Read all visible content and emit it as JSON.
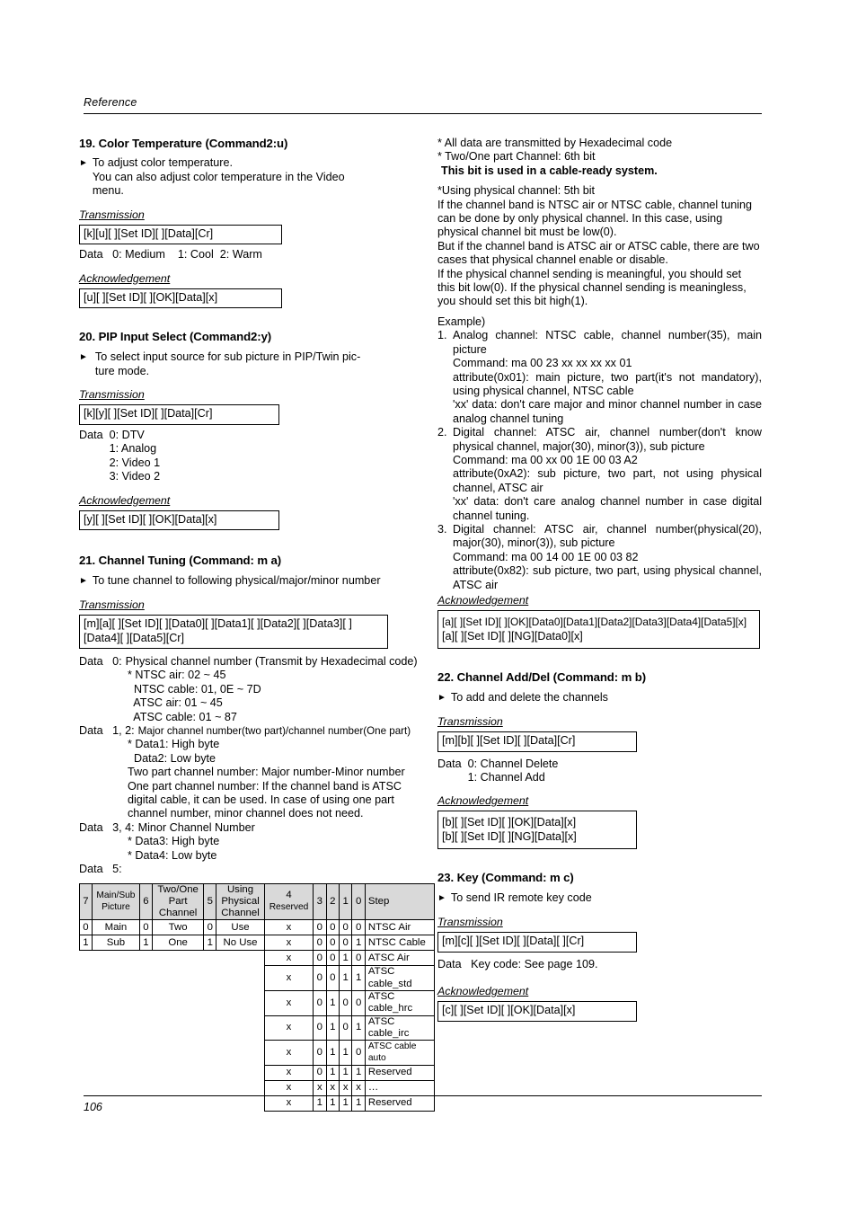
{
  "header": {
    "label": "Reference"
  },
  "footer": {
    "page": "106"
  },
  "left": {
    "s19": {
      "title": "19. Color Temperature (Command2:u)",
      "bullet": "To adjust color temperature.\nYou can also adjust color temperature in the Video\nmenu.",
      "transmission_label": "Transmission",
      "transmission_code": "[k][u][  ][Set ID][  ][Data][Cr]",
      "data_line": "Data   0: Medium    1: Cool  2: Warm",
      "ack_label": "Acknowledgement",
      "ack_code": "[u][  ][Set ID][  ][OK][Data][x]"
    },
    "s20": {
      "title": "20. PIP Input Select (Command2:y)",
      "bullet": "To select input source for sub picture in PIP/Twin pic-\nture mode.",
      "transmission_label": "Transmission",
      "transmission_code": "[k][y][  ][Set ID][  ][Data][Cr]",
      "data_key": "Data  ",
      "data_values": [
        "0: DTV",
        "1: Analog",
        "2: Video 1",
        "3: Video 2"
      ],
      "ack_label": "Acknowledgement",
      "ack_code": "[y][  ][Set ID][  ][OK][Data][x]"
    },
    "s21": {
      "title": "21. Channel Tuning (Command: m a)",
      "bullet": "To tune channel to following physical/major/minor number",
      "transmission_label": "Transmission",
      "transmission_code": "[m][a][  ][Set ID][  ][Data0][  ][Data1][  ][Data2][  ][Data3][  ]\n[Data4][  ][Data5][Cr]",
      "data0_key": "Data   0:",
      "data0_val": "Physical channel number (Transmit by Hexadecimal code)",
      "data0_sub": [
        "* NTSC air: 02 ~ 45",
        "  NTSC cable: 01, 0E ~ 7D",
        "  ATSC air: 01 ~ 45",
        "  ATSC cable: 01 ~ 87"
      ],
      "data12_key": "Data   1, 2:",
      "data12_val": "Major channel number(two part)/channel number(One part)",
      "data12_sub": [
        "* Data1: High byte",
        "  Data2: Low byte",
        "Two part channel number: Major number-Minor number",
        "One part channel number: If the channel band is ATSC",
        "digital cable, it can be used. In case of using one part",
        "channel number, minor channel does not need."
      ],
      "data34_key": "Data   3, 4:",
      "data34_val": "Minor Channel Number",
      "data34_sub": [
        "* Data3: High byte",
        "* Data4: Low byte"
      ],
      "data5_key": "Data   5:"
    },
    "bit_table": {
      "headers": [
        "7",
        "Main/Sub Picture",
        "6",
        "Two/One Part Channel",
        "5",
        "Using Physical Channel",
        "4 Reserved",
        "3",
        "2",
        "1",
        "0",
        "Step"
      ],
      "header_res_num": "4",
      "header_res_word": "Reserved",
      "rows": [
        {
          "b7": "0",
          "n7": "Main",
          "b6": "0",
          "n6": "Two",
          "b5": "0",
          "n5": "Use",
          "r4": "x",
          "b3": "0",
          "b2": "0",
          "b1": "0",
          "b0": "0",
          "step": "NTSC Air"
        },
        {
          "b7": "1",
          "n7": "Sub",
          "b6": "1",
          "n6": "One",
          "b5": "1",
          "n5": "No Use",
          "r4": "x",
          "b3": "0",
          "b2": "0",
          "b1": "0",
          "b0": "1",
          "step": "NTSC Cable"
        },
        {
          "r4": "x",
          "b3": "0",
          "b2": "0",
          "b1": "1",
          "b0": "0",
          "step": "ATSC Air"
        },
        {
          "r4": "x",
          "b3": "0",
          "b2": "0",
          "b1": "1",
          "b0": "1",
          "step": "ATSC cable_std"
        },
        {
          "r4": "x",
          "b3": "0",
          "b2": "1",
          "b1": "0",
          "b0": "0",
          "step": "ATSC cable_hrc"
        },
        {
          "r4": "x",
          "b3": "0",
          "b2": "1",
          "b1": "0",
          "b0": "1",
          "step": "ATSC cable_irc"
        },
        {
          "r4": "x",
          "b3": "0",
          "b2": "1",
          "b1": "1",
          "b0": "0",
          "step": "ATSC cable auto"
        },
        {
          "r4": "x",
          "b3": "0",
          "b2": "1",
          "b1": "1",
          "b0": "1",
          "step": "Reserved"
        },
        {
          "r4": "x",
          "b3": "x",
          "b2": "x",
          "b1": "x",
          "b0": "x",
          "step": "…"
        },
        {
          "r4": "x",
          "b3": "1",
          "b2": "1",
          "b1": "1",
          "b0": "1",
          "step": "Reserved"
        }
      ]
    }
  },
  "right": {
    "notes": {
      "line1": "* All data are transmitted by Hexadecimal code",
      "line2": "* Two/One part Channel: 6th bit",
      "line3_bold": "This bit is used in a cable-ready system.",
      "line4": "*Using physical channel: 5th bit",
      "para1": "If the channel band is NTSC air or NTSC cable, channel tuning can be done by only physical channel. In this case, using physical channel bit must be low(0).",
      "para2": "But if the channel band is ATSC air or ATSC cable, there are two cases that physical channel enable or disable.",
      "para3": "If the physical channel sending is meaningful, you should set this bit low(0). If the physical channel sending is meaningless, you should set this bit high(1)."
    },
    "example": {
      "label": "Example)",
      "items": [
        {
          "num": "1.",
          "lines": [
            "Analog channel: NTSC cable, channel number(35), main picture",
            "Command: ma 00 23 xx xx xx xx 01",
            "attribute(0x01): main picture, two part(it's not mandatory), using physical channel, NTSC cable",
            "'xx' data: don't care major and minor channel number in case analog channel tuning"
          ]
        },
        {
          "num": "2.",
          "lines": [
            "Digital channel: ATSC air, channel number(don't know physical channel, major(30), minor(3)), sub picture",
            "Command: ma 00 xx 00 1E 00 03 A2",
            "attribute(0xA2): sub picture, two part, not using physical channel, ATSC air",
            "'xx' data: don't care analog channel number in case digital channel tuning."
          ]
        },
        {
          "num": "3.",
          "lines": [
            "Digital channel: ATSC air, channel number(physical(20), major(30), minor(3)), sub picture",
            "Command: ma 00 14 00 1E 00 03 82",
            "attribute(0x82): sub picture, two part, using physical channel, ATSC air"
          ]
        }
      ]
    },
    "s21ack": {
      "ack_label": "Acknowledgement",
      "ack_code_1": "[a][  ][Set ID][  ][OK][Data0][Data1][Data2][Data3][Data4][Data5][x]",
      "ack_code_2": "[a][  ][Set ID][  ][NG][Data0][x]"
    },
    "s22": {
      "title": "22. Channel Add/Del (Command: m b)",
      "bullet": "To add and delete the channels",
      "transmission_label": "Transmission",
      "transmission_code": "[m][b][  ][Set ID][  ][Data][Cr]",
      "data_key": "Data  ",
      "data_values": [
        "0: Channel Delete",
        "1: Channel Add"
      ],
      "ack_label": "Acknowledgement",
      "ack_code_1": "[b][  ][Set ID][  ][OK][Data][x]",
      "ack_code_2": "[b][  ][Set ID][  ][NG][Data][x]"
    },
    "s23": {
      "title": "23. Key (Command: m c)",
      "bullet": "To send IR remote key code",
      "transmission_label": "Transmission",
      "transmission_code": "[m][c][  ][Set ID][  ][Data][  ][Cr]",
      "data_line": "Data   Key code: See page 109.",
      "ack_label": "Acknowledgement",
      "ack_code": "[c][  ][Set ID][  ][OK][Data][x]"
    }
  }
}
